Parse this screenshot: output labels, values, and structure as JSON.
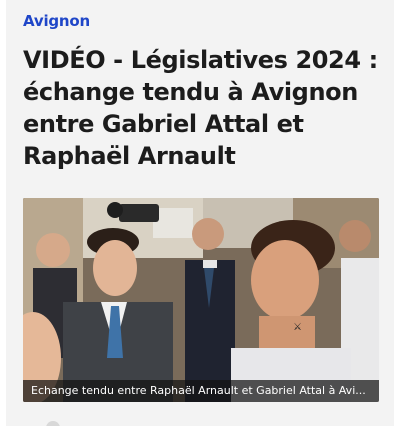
{
  "article": {
    "category": "Avignon",
    "headline": "VIDÉO - Législatives 2024 : échange tendu à Avignon entre Gabriel Attal et Raphaël Arnault",
    "image_caption": "Echange tendu entre Raphaël Arnault et Gabriel Attal à Avi..."
  },
  "colors": {
    "category": "#1f46c8",
    "headline": "#1c1c1c",
    "card_background": "#f3f3f3",
    "caption_background": "rgba(20,20,20,0.72)"
  }
}
